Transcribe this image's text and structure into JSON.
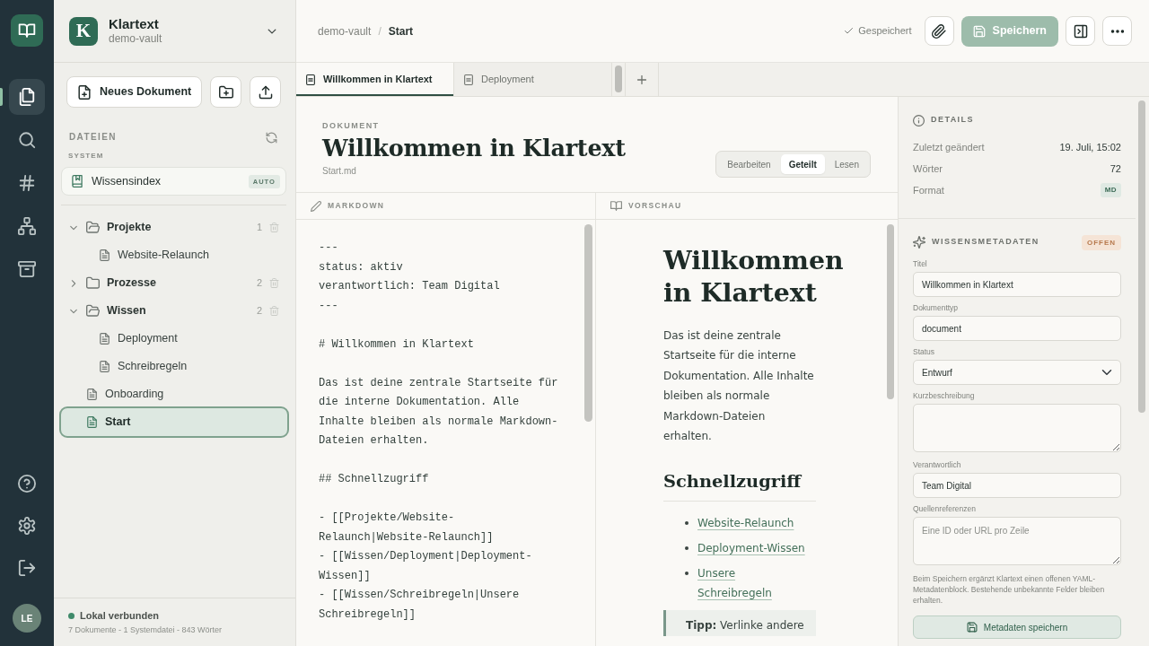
{
  "rail": {
    "items": [
      {
        "kind": "files",
        "selected": true
      },
      {
        "kind": "search",
        "selected": false
      },
      {
        "kind": "tags",
        "selected": false
      },
      {
        "kind": "graph",
        "selected": false
      },
      {
        "kind": "archive",
        "selected": false
      }
    ],
    "bottom": [
      {
        "kind": "help"
      },
      {
        "kind": "settings"
      },
      {
        "kind": "logout"
      }
    ],
    "avatar": "LE"
  },
  "workspace": {
    "logo_letter": "K",
    "name": "Klartext",
    "vault": "demo-vault"
  },
  "sidebar": {
    "new_document": "Neues Dokument",
    "section_title": "DATEIEN",
    "system_title": "SYSTEM",
    "system_item": {
      "label": "Wissensindex",
      "badge": "AUTO",
      "selected": false
    },
    "tree": [
      {
        "kind": "folder",
        "label": "Projekte",
        "count": "1",
        "expanded": true,
        "selected": false,
        "children": [
          {
            "kind": "file",
            "label": "Website-Relaunch",
            "selected": false
          }
        ]
      },
      {
        "kind": "folder",
        "label": "Prozesse",
        "count": "2",
        "expanded": false,
        "selected": false
      },
      {
        "kind": "folder",
        "label": "Wissen",
        "count": "2",
        "expanded": true,
        "selected": false,
        "children": [
          {
            "kind": "file",
            "label": "Deployment",
            "selected": false
          },
          {
            "kind": "file",
            "label": "Schreibregeln",
            "selected": false
          }
        ]
      },
      {
        "kind": "file",
        "label": "Onboarding",
        "selected": false
      },
      {
        "kind": "file",
        "label": "Start",
        "selected": true
      }
    ],
    "status": {
      "label": "Lokal verbunden",
      "summary": "7 Dokumente - 1 Systemdatei - 843 Wörter"
    }
  },
  "topbar": {
    "breadcrumb": [
      "demo-vault",
      "Start"
    ],
    "separator": "/",
    "save_status": "Gespeichert",
    "save_button": {
      "label": "Speichern",
      "disabled": true
    }
  },
  "tabs": [
    {
      "label": "Willkommen in Klartext",
      "selected": true
    },
    {
      "label": "Deployment",
      "selected": false
    }
  ],
  "document": {
    "eyebrow": "DOKUMENT",
    "title": "Willkommen in Klartext",
    "file_name": "Start.md",
    "view_modes": [
      {
        "label": "Bearbeiten",
        "selected": false
      },
      {
        "label": "Geteilt",
        "selected": true
      },
      {
        "label": "Lesen",
        "selected": false
      }
    ]
  },
  "editor": {
    "title": "MARKDOWN",
    "blocks": [
      "---\nstatus: aktiv\nverantwortlich: Team Digital\n---",
      "# Willkommen in Klartext",
      "Das ist deine zentrale Startseite für die interne Dokumentation. Alle Inhalte bleiben als normale Markdown-Dateien erhalten.",
      "## Schnellzugriff",
      "- [[Projekte/Website-Relaunch|Website-Relaunch]]\n- [[Wissen/Deployment|Deployment-Wissen]]\n- [[Wissen/Schreibregeln|Unsere Schreibregeln]]"
    ]
  },
  "preview": {
    "title": "VORSCHAU",
    "heading": "Willkommen in Klartext",
    "paragraph": "Das ist deine zentrale Startseite für die interne Dokumentation. Alle Inhalte bleiben als normale Markdown-Dateien erhalten.",
    "subheading": "Schnellzugriff",
    "links": [
      "Website-Relaunch",
      "Deployment-Wissen",
      "Unsere Schreibregeln"
    ],
    "tip": "**Tipp:** Verlinke andere"
  },
  "details": {
    "title": "DETAILS",
    "rows": [
      {
        "kind": "text",
        "label": "Zuletzt geändert",
        "value": "19. Juli, 15:02"
      },
      {
        "kind": "text",
        "label": "Wörter",
        "value": "72"
      },
      {
        "kind": "badge",
        "label": "Format",
        "value": "MD"
      }
    ]
  },
  "metadata": {
    "title": "WISSENSMETADATEN",
    "badge": "OFFEN",
    "fields": [
      {
        "kind": "input",
        "label": "Titel",
        "value": "Willkommen in Klartext"
      },
      {
        "kind": "input",
        "label": "Dokumenttyp",
        "value": "document"
      },
      {
        "kind": "select",
        "label": "Status",
        "value": "Entwurf"
      },
      {
        "kind": "textarea",
        "label": "Kurzbeschreibung"
      },
      {
        "kind": "input",
        "label": "Verantwortlich",
        "value": "Team Digital"
      },
      {
        "kind": "textarea",
        "label": "Quellenreferenzen",
        "placeholder": "Eine ID oder URL pro Zeile"
      }
    ],
    "note": "Beim Speichern ergänzt Klartext einen offenen YAML-Metadatenblock. Bestehende unbekannte Felder bleiben erhalten.",
    "save_button": "Metadaten speichern"
  }
}
